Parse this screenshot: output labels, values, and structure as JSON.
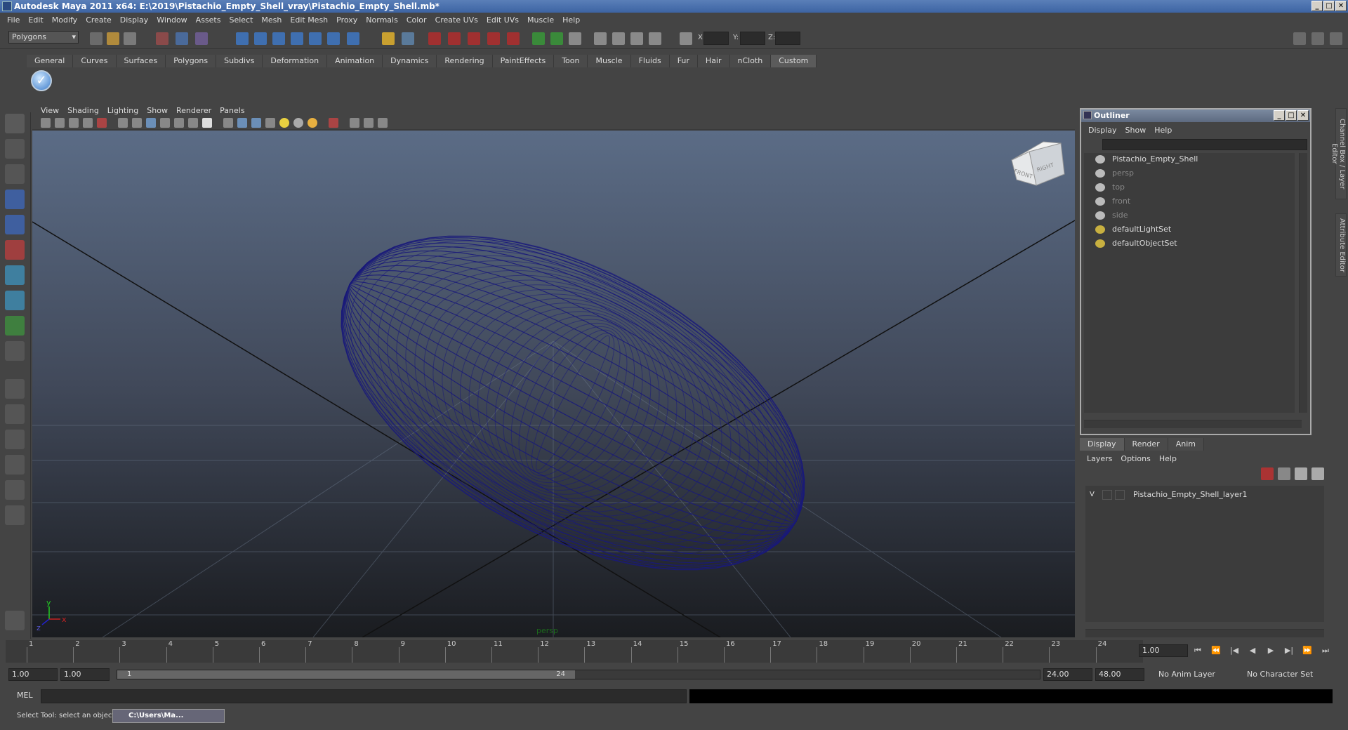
{
  "window": {
    "title": "Autodesk Maya 2011 x64: E:\\2019\\Pistachio_Empty_Shell_vray\\Pistachio_Empty_Shell.mb*",
    "controls": [
      "_",
      "□",
      "✕"
    ]
  },
  "menubar": [
    "File",
    "Edit",
    "Modify",
    "Create",
    "Display",
    "Window",
    "Assets",
    "Select",
    "Mesh",
    "Edit Mesh",
    "Proxy",
    "Normals",
    "Color",
    "Create UVs",
    "Edit UVs",
    "Muscle",
    "Help"
  ],
  "statusline": {
    "mode": "Polygons",
    "x_label": "X:",
    "y_label": "Y:",
    "z_label": "Z:"
  },
  "shelf": {
    "tabs": [
      "General",
      "Curves",
      "Surfaces",
      "Polygons",
      "Subdivs",
      "Deformation",
      "Animation",
      "Dynamics",
      "Rendering",
      "PaintEffects",
      "Toon",
      "Muscle",
      "Fluids",
      "Fur",
      "Hair",
      "nCloth",
      "Custom"
    ],
    "active_tab": "Custom"
  },
  "viewport": {
    "menu": [
      "View",
      "Shading",
      "Lighting",
      "Show",
      "Renderer",
      "Panels"
    ],
    "camera_label": "persp",
    "viewcube": {
      "front": "FRONT",
      "right": "RIGHT"
    },
    "axis": {
      "y": "y",
      "x": "x",
      "z": "z"
    },
    "wire_color": "#1a1a7a"
  },
  "outliner": {
    "title": "Outliner",
    "menu": [
      "Display",
      "Show",
      "Help"
    ],
    "items": [
      {
        "label": "Pistachio_Empty_Shell",
        "dim": false
      },
      {
        "label": "persp",
        "dim": true
      },
      {
        "label": "top",
        "dim": true
      },
      {
        "label": "front",
        "dim": true
      },
      {
        "label": "side",
        "dim": true
      },
      {
        "label": "defaultLightSet",
        "dim": false
      },
      {
        "label": "defaultObjectSet",
        "dim": false
      }
    ]
  },
  "layers": {
    "tabs": [
      "Display",
      "Render",
      "Anim"
    ],
    "menu": [
      "Layers",
      "Options",
      "Help"
    ],
    "rows": [
      {
        "visible": "V",
        "name": "Pistachio_Empty_Shell_layer1"
      }
    ]
  },
  "side_tabs": [
    "Channel Box / Layer Editor",
    "Attribute Editor"
  ],
  "timeline": {
    "ticks": [
      "1",
      "2",
      "3",
      "4",
      "5",
      "6",
      "7",
      "8",
      "9",
      "10",
      "11",
      "12",
      "13",
      "14",
      "15",
      "16",
      "17",
      "18",
      "19",
      "20",
      "21",
      "22",
      "23",
      "24"
    ],
    "current_frame": "1.00",
    "playback": [
      "⏮",
      "⏪",
      "|◀",
      "◀",
      "▶",
      "▶|",
      "⏩",
      "⏭"
    ]
  },
  "range": {
    "start": "1.00",
    "start2": "1.00",
    "slider_start": "1",
    "slider_end": "24",
    "end": "24.00",
    "end2": "48.00",
    "anim_layer": "No Anim Layer",
    "char_set": "No Character Set"
  },
  "mel": {
    "label": "MEL"
  },
  "help": {
    "text": "Select Tool: select an object",
    "task": "C:\\Users\\Ma..."
  }
}
